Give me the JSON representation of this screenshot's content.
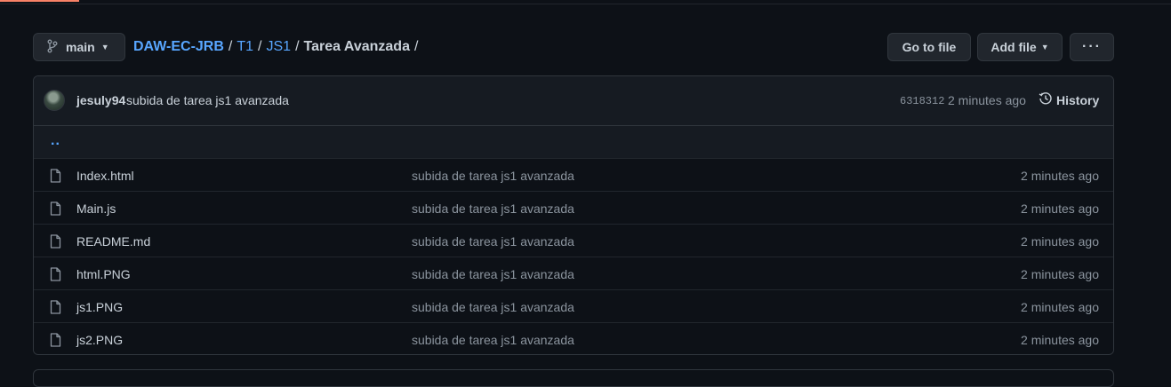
{
  "branch": {
    "label": "main"
  },
  "breadcrumb": {
    "repo": "DAW-EC-JRB",
    "segments": [
      "T1",
      "JS1"
    ],
    "current": "Tarea Avanzada",
    "trailing_sep": "/"
  },
  "actions": {
    "goto_file": "Go to file",
    "add_file": "Add file",
    "more": "···"
  },
  "commit": {
    "author": "jesuly94",
    "message": "subida de tarea js1 avanzada",
    "sha": "6318312",
    "time": "2 minutes ago",
    "history_label": "History"
  },
  "parent_dir": "..",
  "files": [
    {
      "name": "Index.html",
      "message": "subida de tarea js1 avanzada",
      "time": "2 minutes ago"
    },
    {
      "name": "Main.js",
      "message": "subida de tarea js1 avanzada",
      "time": "2 minutes ago"
    },
    {
      "name": "README.md",
      "message": "subida de tarea js1 avanzada",
      "time": "2 minutes ago"
    },
    {
      "name": "html.PNG",
      "message": "subida de tarea js1 avanzada",
      "time": "2 minutes ago"
    },
    {
      "name": "js1.PNG",
      "message": "subida de tarea js1 avanzada",
      "time": "2 minutes ago"
    },
    {
      "name": "js2.PNG",
      "message": "subida de tarea js1 avanzada",
      "time": "2 minutes ago"
    }
  ],
  "icons": {
    "branch": "git-branch-icon",
    "history": "history-clock-icon",
    "file": "file-icon"
  },
  "colors": {
    "background": "#0d1117",
    "link": "#58a6ff",
    "border": "#30363d",
    "muted": "#8b949e",
    "active_tab": "#f78166"
  }
}
